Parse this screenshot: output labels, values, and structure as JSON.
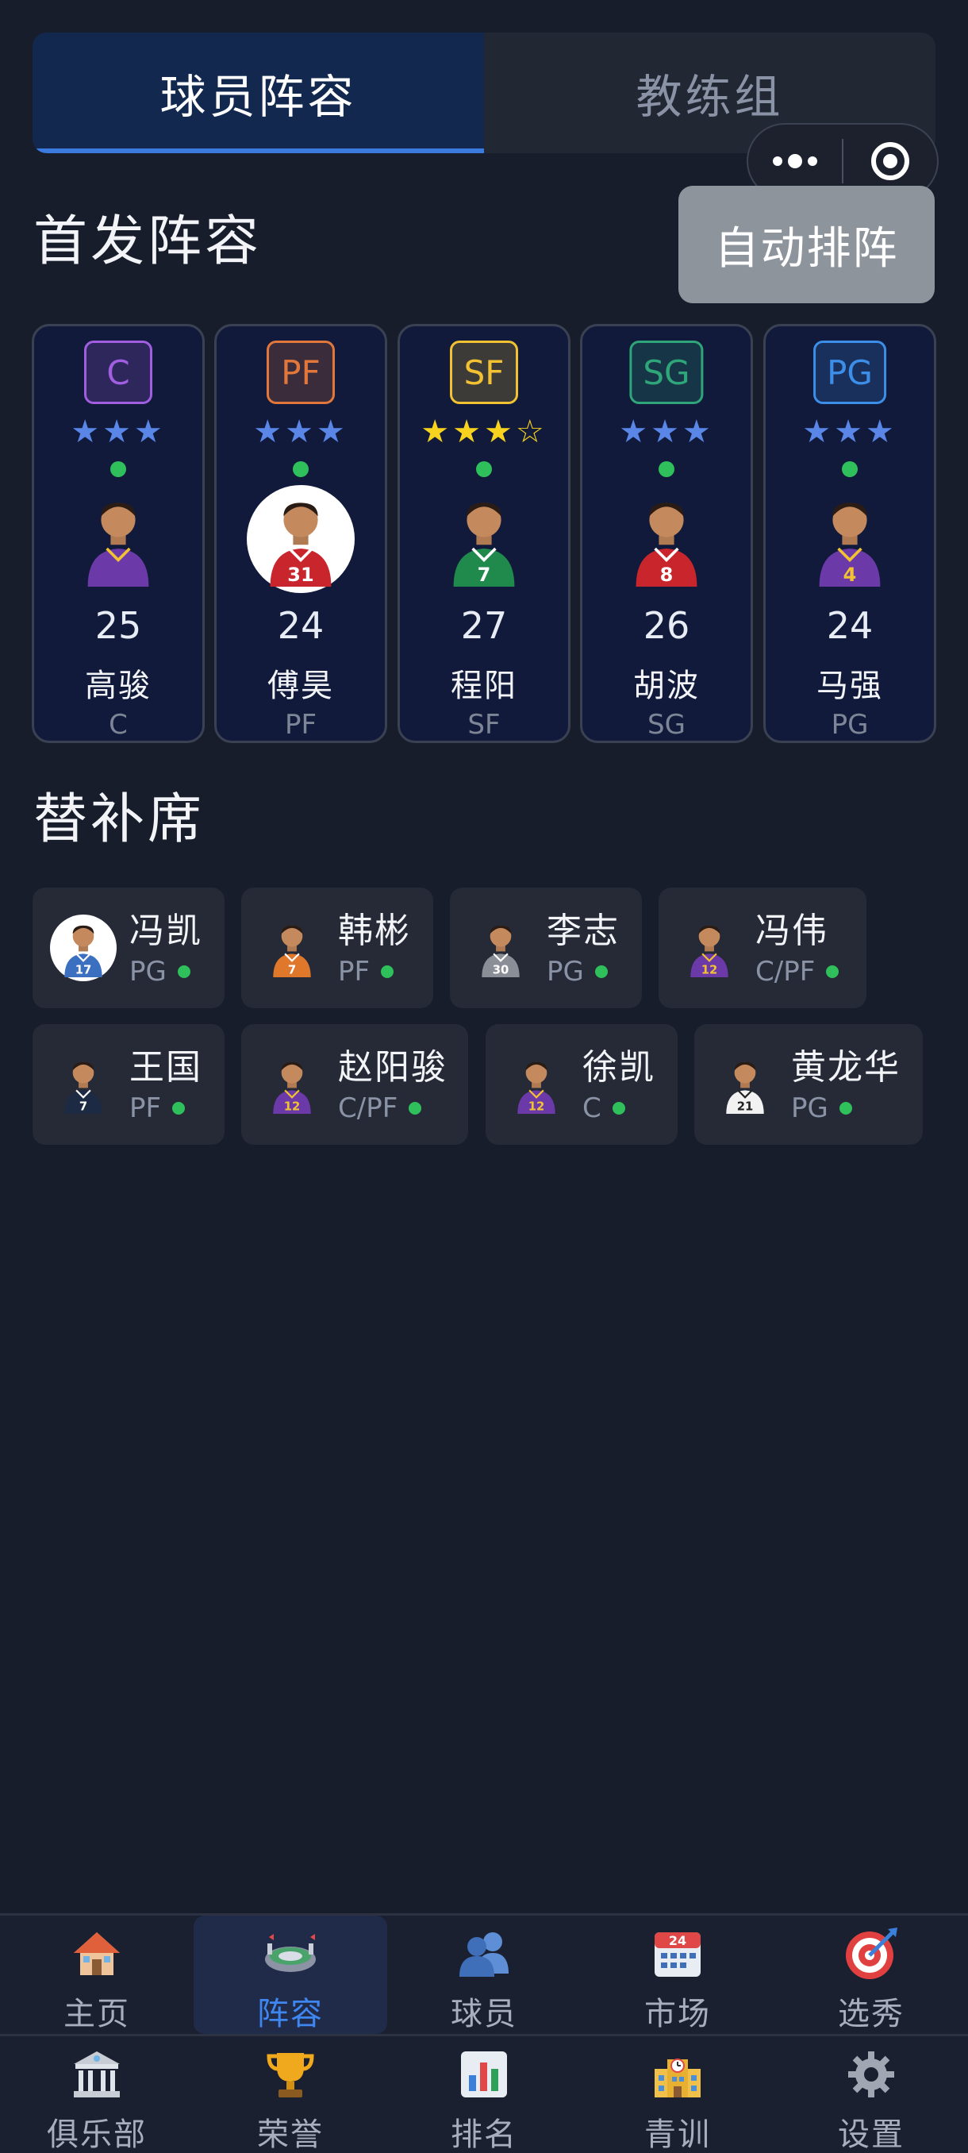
{
  "tabs": [
    {
      "label": "球员阵容",
      "active": true
    },
    {
      "label": "教练组",
      "active": false
    }
  ],
  "starters_section": {
    "title": "首发阵容",
    "auto_button": "自动排阵"
  },
  "starters": [
    {
      "badge": "C",
      "badge_color": "#a15ee0",
      "stars": "★★★",
      "star_color": "#5a86e8",
      "age": "25",
      "name": "高骏",
      "position": "C",
      "jersey": "",
      "avatar": "player-purple-avatar"
    },
    {
      "badge": "PF",
      "badge_color": "#e2773c",
      "stars": "★★★",
      "star_color": "#5a86e8",
      "age": "24",
      "name": "傅昊",
      "position": "PF",
      "jersey": "31",
      "avatar": "player-red-avatar"
    },
    {
      "badge": "SF",
      "badge_color": "#f2c233",
      "stars": "★★★☆",
      "star_color": "#f7d21e",
      "age": "27",
      "name": "程阳",
      "position": "SF",
      "jersey": "7",
      "avatar": "player-green-avatar"
    },
    {
      "badge": "SG",
      "badge_color": "#2fa57a",
      "stars": "★★★",
      "star_color": "#5a86e8",
      "age": "26",
      "name": "胡波",
      "position": "SG",
      "jersey": "8",
      "avatar": "player-red-avatar"
    },
    {
      "badge": "PG",
      "badge_color": "#3c8ee8",
      "stars": "★★★",
      "star_color": "#5a86e8",
      "age": "24",
      "name": "马强",
      "position": "PG",
      "jersey": "4",
      "avatar": "player-purple-avatar"
    }
  ],
  "bench_section": {
    "title": "替补席"
  },
  "bench": [
    {
      "name": "冯凯",
      "position": "PG",
      "jersey": "17",
      "avatar": "player-blue-avatar"
    },
    {
      "name": "韩彬",
      "position": "PF",
      "jersey": "7",
      "avatar": "player-orange-avatar"
    },
    {
      "name": "李志",
      "position": "PG",
      "jersey": "30",
      "avatar": "player-gray-avatar"
    },
    {
      "name": "冯伟",
      "position": "C/PF",
      "jersey": "12",
      "avatar": "player-purple-avatar"
    },
    {
      "name": "王国",
      "position": "PF",
      "jersey": "7",
      "avatar": "player-navy-avatar"
    },
    {
      "name": "赵阳骏",
      "position": "C/PF",
      "jersey": "12",
      "avatar": "player-purple-avatar"
    },
    {
      "name": "徐凯",
      "position": "C",
      "jersey": "12",
      "avatar": "player-purple-avatar"
    },
    {
      "name": "黄龙华",
      "position": "PG",
      "jersey": "21",
      "avatar": "player-white-avatar"
    }
  ],
  "nav": {
    "row1": [
      {
        "label": "主页",
        "icon": "house-icon",
        "active": false
      },
      {
        "label": "阵容",
        "icon": "stadium-icon",
        "active": true
      },
      {
        "label": "球员",
        "icon": "users-icon",
        "active": false
      },
      {
        "label": "市场",
        "icon": "calendar-icon",
        "active": false
      },
      {
        "label": "选秀",
        "icon": "target-icon",
        "active": false
      }
    ],
    "row2": [
      {
        "label": "俱乐部",
        "icon": "building-icon",
        "active": false
      },
      {
        "label": "荣誉",
        "icon": "trophy-icon",
        "active": false
      },
      {
        "label": "排名",
        "icon": "bar-chart-icon",
        "active": false
      },
      {
        "label": "青训",
        "icon": "school-icon",
        "active": false
      },
      {
        "label": "设置",
        "icon": "gear-icon",
        "active": false
      }
    ]
  },
  "calendar_day": "24",
  "colors": {
    "accent": "#3f86f0",
    "active_tab_bg": "#13284f",
    "status_green": "#2fbf5b"
  }
}
